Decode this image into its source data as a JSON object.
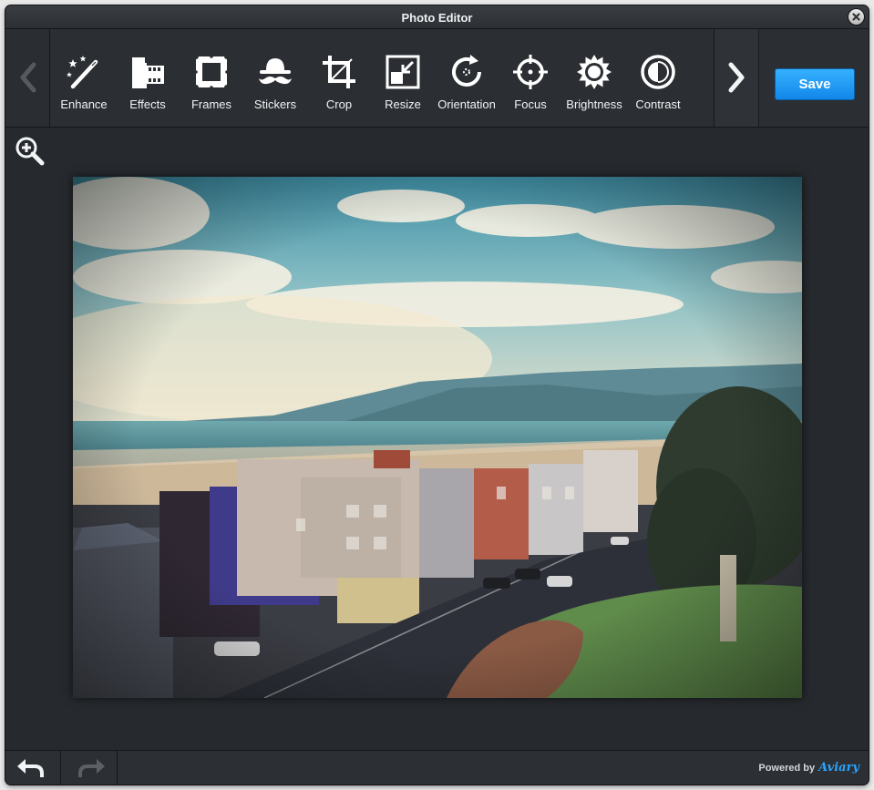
{
  "window": {
    "title": "Photo Editor"
  },
  "toolbar": {
    "tools": [
      {
        "label": "Enhance",
        "icon": "magic-wand-icon"
      },
      {
        "label": "Effects",
        "icon": "film-icon"
      },
      {
        "label": "Frames",
        "icon": "frame-icon"
      },
      {
        "label": "Stickers",
        "icon": "hat-mustache-icon"
      },
      {
        "label": "Crop",
        "icon": "crop-icon"
      },
      {
        "label": "Resize",
        "icon": "resize-icon"
      },
      {
        "label": "Orientation",
        "icon": "rotate-icon"
      },
      {
        "label": "Focus",
        "icon": "crosshair-icon"
      },
      {
        "label": "Brightness",
        "icon": "sun-icon"
      },
      {
        "label": "Contrast",
        "icon": "contrast-icon"
      }
    ],
    "save_label": "Save"
  },
  "footer": {
    "powered_by": "Powered by",
    "brand": "Aviary"
  },
  "colors": {
    "accent": "#1f9bf5",
    "panel": "#2b2e32",
    "background": "#26292d"
  }
}
